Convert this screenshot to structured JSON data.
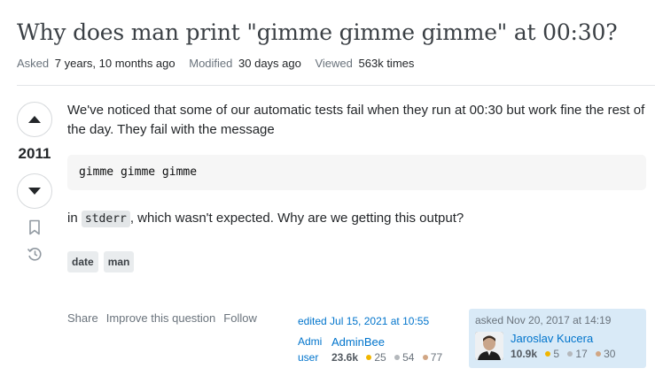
{
  "question": {
    "title": "Why does man print \"gimme gimme gimme\" at 00:30?",
    "meta": {
      "asked_label": "Asked",
      "asked_value": "7 years, 10 months ago",
      "modified_label": "Modified",
      "modified_value": "30 days ago",
      "viewed_label": "Viewed",
      "viewed_value": "563k times"
    },
    "score": "2011",
    "body": {
      "p1": "We've noticed that some of our automatic tests fail when they run at 00:30 but work fine the rest of the day. They fail with the message",
      "code": "gimme gimme gimme",
      "p2_before": "in ",
      "p2_code": "stderr",
      "p2_after": ", which wasn't expected. Why are we getting this output?"
    },
    "tags": [
      "date",
      "man"
    ],
    "actions": {
      "share": "Share",
      "improve": "Improve this question",
      "follow": "Follow"
    },
    "edited": {
      "when": "edited Jul 15, 2021 at 10:55",
      "avatar_alt_line1": "Admi",
      "avatar_alt_line2": "user",
      "user": "AdminBee",
      "rep": "23.6k",
      "gold": "25",
      "silver": "54",
      "bronze": "77"
    },
    "asked": {
      "when": "asked Nov 20, 2017 at 14:19",
      "user": "Jaroslav Kucera",
      "rep": "10.9k",
      "gold": "5",
      "silver": "17",
      "bronze": "30"
    }
  },
  "colors": {
    "link": "#0074cc",
    "tag_text": "#39739d",
    "owner_card_bg": "#d9eaf7"
  },
  "icons": [
    "vote-up-icon",
    "vote-down-icon",
    "bookmark-icon",
    "history-icon"
  ]
}
